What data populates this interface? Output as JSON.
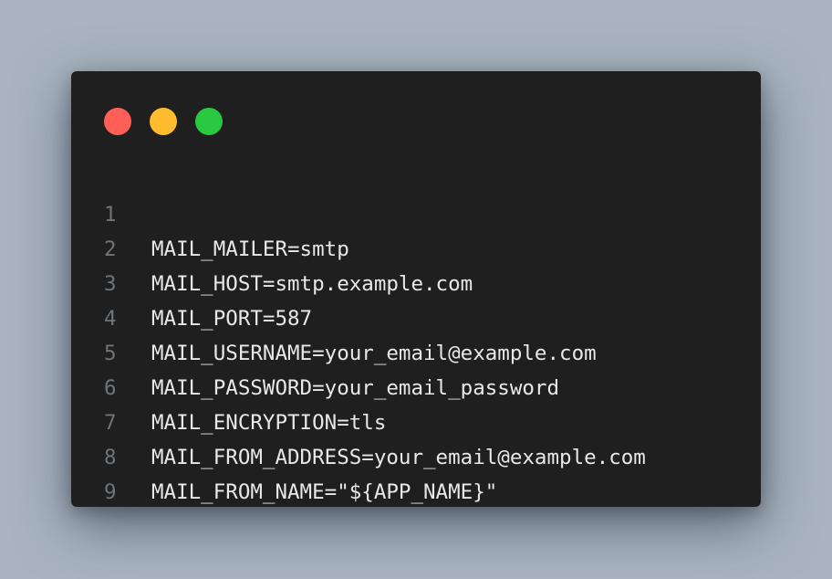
{
  "colors": {
    "background": "#a9b4c0",
    "window": "#1f1f1f",
    "line_number": "#6f7479",
    "code_text": "#e8e8e8",
    "close": "#ff5f57",
    "minimize": "#febc2e",
    "maximize": "#28c840"
  },
  "window_controls": [
    {
      "name": "close-dot",
      "color": "#ff5f57"
    },
    {
      "name": "minimize-dot",
      "color": "#febc2e"
    },
    {
      "name": "maximize-dot",
      "color": "#28c840"
    }
  ],
  "code": {
    "lines": [
      {
        "number": "1",
        "text": "MAIL_MAILER=smtp"
      },
      {
        "number": "2",
        "text": "MAIL_HOST=smtp.example.com"
      },
      {
        "number": "3",
        "text": "MAIL_PORT=587"
      },
      {
        "number": "4",
        "text": "MAIL_USERNAME=your_email@example.com"
      },
      {
        "number": "5",
        "text": "MAIL_PASSWORD=your_email_password"
      },
      {
        "number": "6",
        "text": "MAIL_ENCRYPTION=tls"
      },
      {
        "number": "7",
        "text": "MAIL_FROM_ADDRESS=your_email@example.com"
      },
      {
        "number": "8",
        "text": "MAIL_FROM_NAME=\"${APP_NAME}\""
      },
      {
        "number": "9",
        "text": ""
      }
    ]
  }
}
